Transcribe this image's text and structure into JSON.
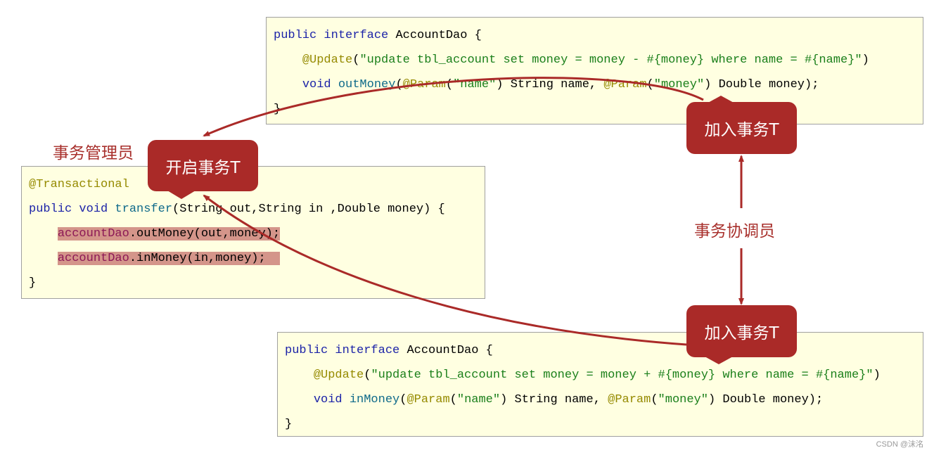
{
  "labels": {
    "manager": "事务管理员",
    "coordinator": "事务协调员"
  },
  "callouts": {
    "start": "开启事务T",
    "join_top": "加入事务T",
    "join_bottom": "加入事务T"
  },
  "colors": {
    "accent": "#aa2a28",
    "code_bg": "#ffffe1",
    "highlight": "#d4958a"
  },
  "code_blocks": {
    "out_dao": [
      [
        [
          "public interface ",
          "kw"
        ],
        [
          "AccountDao {",
          "pl"
        ]
      ],
      [
        [
          "    ",
          "pl"
        ],
        [
          "@Update",
          "an"
        ],
        [
          "(",
          "pl"
        ],
        [
          "\"update tbl_account set money = money - #{money} where name = #{name}\"",
          "st"
        ],
        [
          ")",
          "pl"
        ]
      ],
      [
        [
          "    ",
          "pl"
        ],
        [
          "void ",
          "kw"
        ],
        [
          "outMoney",
          "fn"
        ],
        [
          "(",
          "pl"
        ],
        [
          "@Param",
          "an"
        ],
        [
          "(",
          "pl"
        ],
        [
          "\"name\"",
          "st"
        ],
        [
          ") String name, ",
          "pl"
        ],
        [
          "@Param",
          "an"
        ],
        [
          "(",
          "pl"
        ],
        [
          "\"money\"",
          "st"
        ],
        [
          ") Double money);",
          "pl"
        ]
      ],
      [
        [
          "}",
          "pl"
        ]
      ]
    ],
    "service": [
      [
        [
          "@Transactional",
          "an"
        ]
      ],
      [
        [
          "public void ",
          "kw"
        ],
        [
          "transfer",
          "fn"
        ],
        [
          "(String out,String in ,Double money) {",
          "pl"
        ]
      ],
      [
        [
          "    ",
          "pl"
        ],
        [
          "accountDao",
          "fld hl"
        ],
        [
          ".outMoney(out,money);",
          "pl hl"
        ]
      ],
      [
        [
          "    ",
          "pl"
        ],
        [
          "accountDao",
          "fld hl"
        ],
        [
          ".inMoney(in,money);  ",
          "pl hl"
        ]
      ],
      [
        [
          "}",
          "pl"
        ]
      ]
    ],
    "in_dao": [
      [
        [
          "public interface ",
          "kw"
        ],
        [
          "AccountDao {",
          "pl"
        ]
      ],
      [
        [
          "    ",
          "pl"
        ],
        [
          "@Update",
          "an"
        ],
        [
          "(",
          "pl"
        ],
        [
          "\"update tbl_account set money = money + #{money} where name = #{name}\"",
          "st"
        ],
        [
          ")",
          "pl"
        ]
      ],
      [
        [
          "    ",
          "pl"
        ],
        [
          "void ",
          "kw"
        ],
        [
          "inMoney",
          "fn"
        ],
        [
          "(",
          "pl"
        ],
        [
          "@Param",
          "an"
        ],
        [
          "(",
          "pl"
        ],
        [
          "\"name\"",
          "st"
        ],
        [
          ") String name, ",
          "pl"
        ],
        [
          "@Param",
          "an"
        ],
        [
          "(",
          "pl"
        ],
        [
          "\"money\"",
          "st"
        ],
        [
          ") Double money);",
          "pl"
        ]
      ],
      [
        [
          "}",
          "pl"
        ]
      ]
    ]
  },
  "watermark": "CSDN @沫洺"
}
